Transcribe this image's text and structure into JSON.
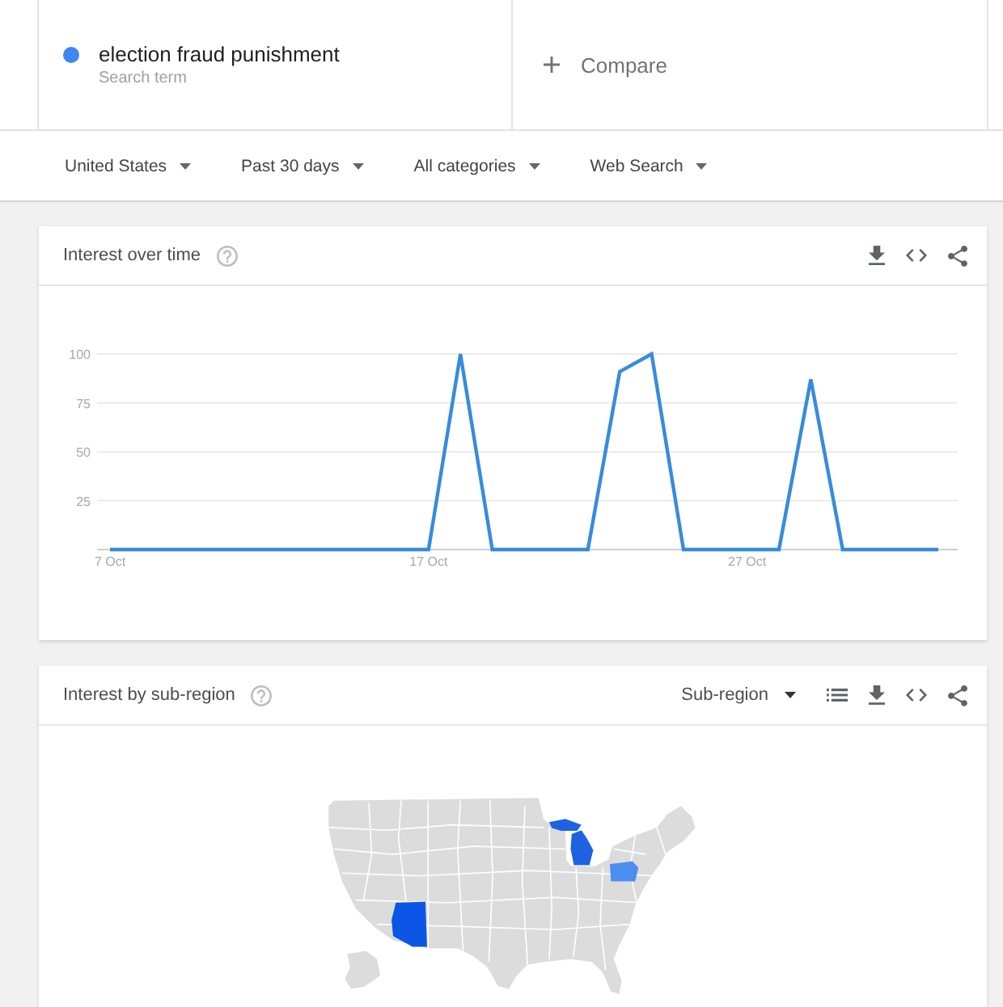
{
  "search_terms": [
    {
      "term": "election fraud punishment",
      "label": "Search term",
      "color": "#4285f4"
    }
  ],
  "compare": {
    "label": "Compare"
  },
  "filters": [
    "United States",
    "Past 30 days",
    "All categories",
    "Web Search"
  ],
  "interest_over_time": {
    "title": "Interest over time",
    "chart_data": {
      "type": "line",
      "categories": [
        "7 Oct",
        null,
        null,
        null,
        null,
        null,
        null,
        null,
        null,
        null,
        "17 Oct",
        null,
        null,
        null,
        null,
        null,
        null,
        null,
        null,
        null,
        "27 Oct",
        null,
        null,
        null,
        null,
        null,
        null
      ],
      "ylim": [
        0,
        100
      ],
      "yticks": [
        25,
        50,
        75,
        100
      ],
      "grid": true,
      "series": [
        {
          "color": "#368cdb",
          "values": [
            0,
            0,
            0,
            0,
            0,
            0,
            0,
            0,
            0,
            0,
            0,
            100,
            0,
            0,
            0,
            0,
            91,
            100,
            0,
            0,
            0,
            0,
            87,
            0,
            0,
            0,
            0
          ]
        }
      ]
    }
  },
  "interest_by_subregion": {
    "title": "Interest by sub-region",
    "resolution": "Sub-region"
  }
}
